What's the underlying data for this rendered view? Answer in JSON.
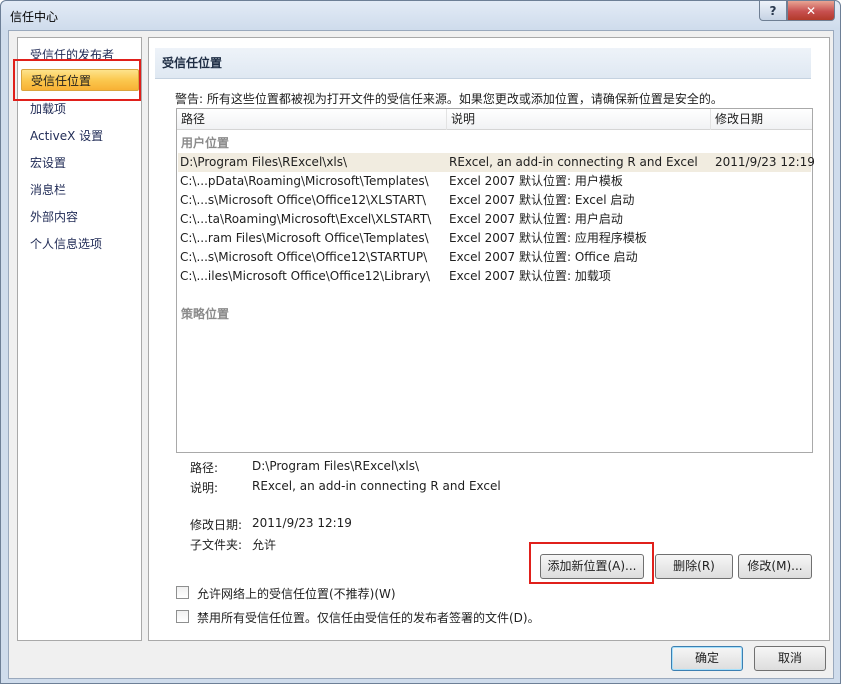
{
  "window": {
    "title": "信任中心",
    "help_glyph": "?",
    "close_glyph": "✕"
  },
  "nav": {
    "items": [
      {
        "label": "受信任的发布者"
      },
      {
        "label": "受信任位置"
      },
      {
        "label": "加载项"
      },
      {
        "label": "ActiveX 设置"
      },
      {
        "label": "宏设置"
      },
      {
        "label": "消息栏"
      },
      {
        "label": "外部内容"
      },
      {
        "label": "个人信息选项"
      }
    ],
    "selected_index": 1
  },
  "panel": {
    "title": "受信任位置",
    "warning": "警告: 所有这些位置都被视为打开文件的受信任来源。如果您更改或添加位置，请确保新位置是安全的。",
    "columns": {
      "path": "路径",
      "description": "说明",
      "modified": "修改日期"
    },
    "groups": {
      "user": "用户位置",
      "policy": "策略位置"
    },
    "rows": [
      {
        "path": "D:\\Program Files\\RExcel\\xls\\",
        "description": "RExcel, an add-in connecting R and Excel",
        "modified": "2011/9/23 12:19"
      },
      {
        "path": "C:\\...pData\\Roaming\\Microsoft\\Templates\\",
        "description": "Excel 2007 默认位置: 用户模板",
        "modified": ""
      },
      {
        "path": "C:\\...s\\Microsoft Office\\Office12\\XLSTART\\",
        "description": "Excel 2007 默认位置: Excel 启动",
        "modified": ""
      },
      {
        "path": "C:\\...ta\\Roaming\\Microsoft\\Excel\\XLSTART\\",
        "description": "Excel 2007 默认位置: 用户启动",
        "modified": ""
      },
      {
        "path": "C:\\...ram Files\\Microsoft Office\\Templates\\",
        "description": "Excel 2007 默认位置: 应用程序模板",
        "modified": ""
      },
      {
        "path": "C:\\...s\\Microsoft Office\\Office12\\STARTUP\\",
        "description": "Excel 2007 默认位置: Office 启动",
        "modified": ""
      },
      {
        "path": "C:\\...iles\\Microsoft Office\\Office12\\Library\\",
        "description": "Excel 2007 默认位置: 加载项",
        "modified": ""
      }
    ],
    "details": {
      "path_label": "路径:",
      "path_value": "D:\\Program Files\\RExcel\\xls\\",
      "desc_label": "说明:",
      "desc_value": "RExcel, an add-in connecting R and Excel",
      "modified_label": "修改日期:",
      "modified_value": "2011/9/23 12:19",
      "subfolders_label": "子文件夹:",
      "subfolders_value": "允许"
    },
    "buttons": {
      "add": "添加新位置(A)...",
      "remove": "删除(R)",
      "modify": "修改(M)..."
    },
    "checkboxes": {
      "allow_network": {
        "label": "允许网络上的受信任位置(不推荐)(W)",
        "checked": false
      },
      "disable_all": {
        "label": "禁用所有受信任位置。仅信任由受信任的发布者签署的文件(D)。",
        "checked": false
      }
    }
  },
  "footer": {
    "ok": "确定",
    "cancel": "取消"
  },
  "colors": {
    "highlight_box": "#e0201b",
    "selected_nav": "#fbc84f",
    "selected_row": "#f1ece0"
  }
}
